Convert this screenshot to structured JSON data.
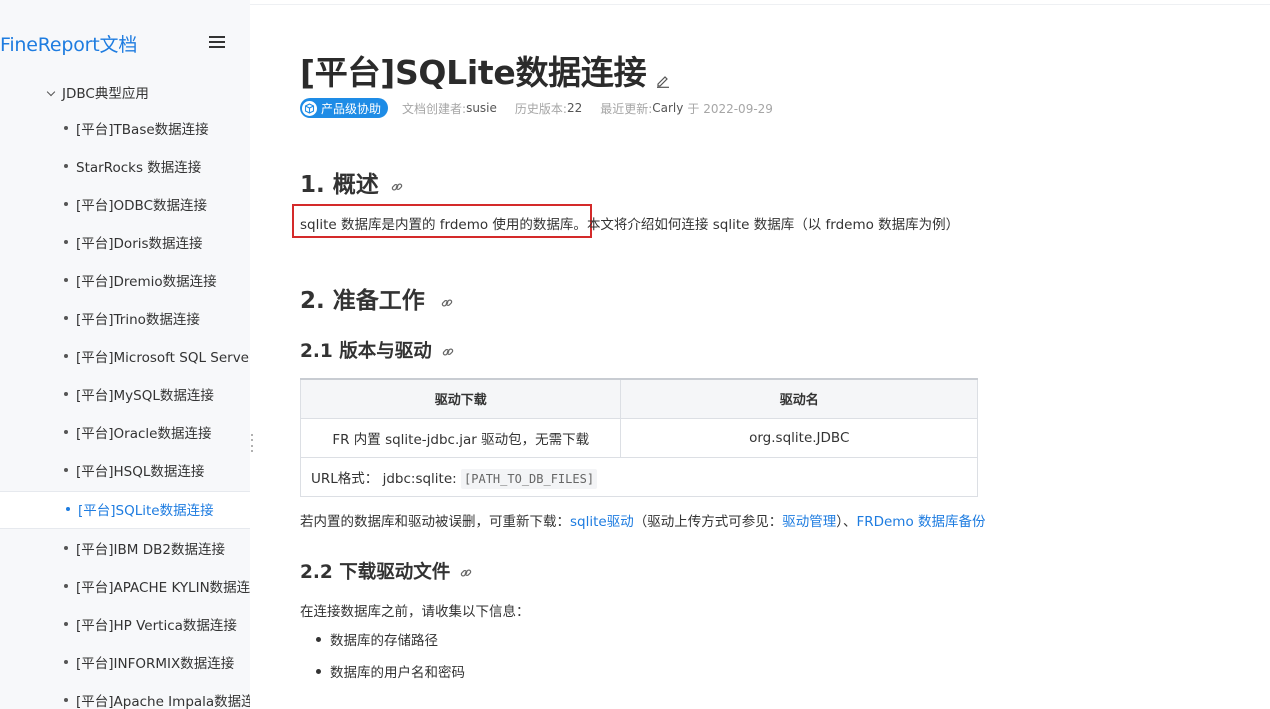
{
  "brand": "FineReport文档",
  "sidebar": {
    "group_label": "JDBC典型应用",
    "items": [
      {
        "label": "[平台]TBase数据连接"
      },
      {
        "label": "StarRocks 数据连接"
      },
      {
        "label": "[平台]ODBC数据连接"
      },
      {
        "label": "[平台]Doris数据连接"
      },
      {
        "label": "[平台]Dremio数据连接"
      },
      {
        "label": "[平台]Trino数据连接"
      },
      {
        "label": "[平台]Microsoft SQL Server数据连接"
      },
      {
        "label": "[平台]MySQL数据连接"
      },
      {
        "label": "[平台]Oracle数据连接"
      },
      {
        "label": "[平台]HSQL数据连接"
      },
      {
        "label": "[平台]SQLite数据连接",
        "active": true
      },
      {
        "label": "[平台]IBM DB2数据连接"
      },
      {
        "label": "[平台]APACHE KYLIN数据连接"
      },
      {
        "label": "[平台]HP Vertica数据连接"
      },
      {
        "label": "[平台]INFORMIX数据连接"
      },
      {
        "label": "[平台]Apache Impala数据连接"
      }
    ]
  },
  "page": {
    "title": "[平台]SQLite数据连接",
    "badge": "产品级协助",
    "meta": {
      "creator_label": "文档创建者:",
      "creator": "susie",
      "history_label": "历史版本:",
      "history": "22",
      "updated_label": "最近更新:",
      "updated_by": "Carly",
      "updated_on": "于 2022-09-29"
    },
    "sec1": {
      "heading": "1. 概述",
      "highlighted": "sqlite 数据库是内置的 frdemo 使用的数据库。",
      "rest": "本文将介绍如何连接 sqlite 数据库（以 frdemo 数据库为例）"
    },
    "sec2": {
      "heading": "2. 准备工作",
      "sub1": "2.1 版本与驱动",
      "table": {
        "headers": [
          "驱动下载",
          "驱动名"
        ],
        "row": [
          "FR 内置 sqlite-jdbc.jar 驱动包，无需下载",
          "org.sqlite.JDBC"
        ],
        "url_label": "URL格式：",
        "url_prefix": "jdbc:sqlite:",
        "url_code": "[PATH_TO_DB_FILES]"
      },
      "note": {
        "text1": "若内置的数据库和驱动被误删，可重新下载：",
        "link1": "sqlite驱动",
        "text2": "（驱动上传方式可参见：",
        "link2": "驱动管理",
        "text3": "）、",
        "link3": "FRDemo 数据库备份"
      },
      "sub2": "2.2 下载驱动文件",
      "intro": "在连接数据库之前，请收集以下信息：",
      "bullets": [
        "数据库的存储路径",
        "数据库的用户名和密码"
      ]
    }
  },
  "colors": {
    "accent": "#1e7ce0",
    "badge": "#1e8ce6",
    "highlight_border": "#d42a2a"
  }
}
